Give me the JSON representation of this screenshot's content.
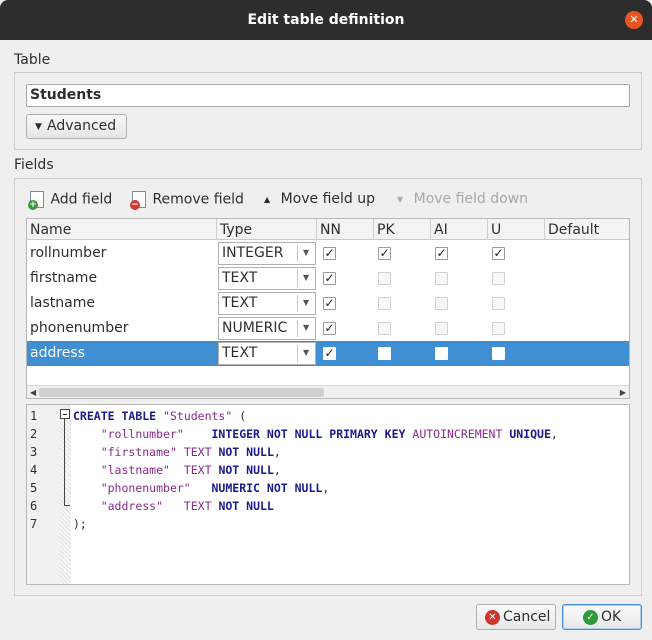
{
  "window": {
    "title": "Edit table definition"
  },
  "table_section": {
    "label": "Table",
    "name_value": "Students",
    "advanced_label": "Advanced"
  },
  "fields_section": {
    "label": "Fields",
    "toolbar": {
      "add_field": "Add field",
      "remove_field": "Remove field",
      "move_up": "Move field up",
      "move_down": "Move field down"
    },
    "columns": [
      "Name",
      "Type",
      "NN",
      "PK",
      "AI",
      "U",
      "Default"
    ],
    "rows": [
      {
        "name": "rollnumber",
        "type": "INTEGER",
        "nn": true,
        "pk": true,
        "ai": true,
        "u": true
      },
      {
        "name": "firstname",
        "type": "TEXT",
        "nn": true,
        "pk": false,
        "ai": false,
        "u": false
      },
      {
        "name": "lastname",
        "type": "TEXT",
        "nn": true,
        "pk": false,
        "ai": false,
        "u": false
      },
      {
        "name": "phonenumber",
        "type": "NUMERIC",
        "nn": true,
        "pk": false,
        "ai": false,
        "u": false
      },
      {
        "name": "address",
        "type": "TEXT",
        "nn": true,
        "pk": false,
        "ai": false,
        "u": false,
        "selected": true
      }
    ]
  },
  "sql_preview": {
    "line_numbers": [
      "1",
      "2",
      "3",
      "4",
      "5",
      "6",
      "7"
    ],
    "lines": [
      "CREATE TABLE \"Students\" (",
      "    \"rollnumber\"    INTEGER NOT NULL PRIMARY KEY AUTOINCREMENT UNIQUE,",
      "    \"firstname\" TEXT NOT NULL,",
      "    \"lastname\"  TEXT NOT NULL,",
      "    \"phonenumber\"   NUMERIC NOT NULL,",
      "    \"address\"   TEXT NOT NULL",
      ");"
    ]
  },
  "buttons": {
    "cancel": "Cancel",
    "ok": "OK"
  },
  "colors": {
    "selection": "#3f8fd2",
    "close": "#e95420",
    "titlebar": "#2d2d2d"
  }
}
